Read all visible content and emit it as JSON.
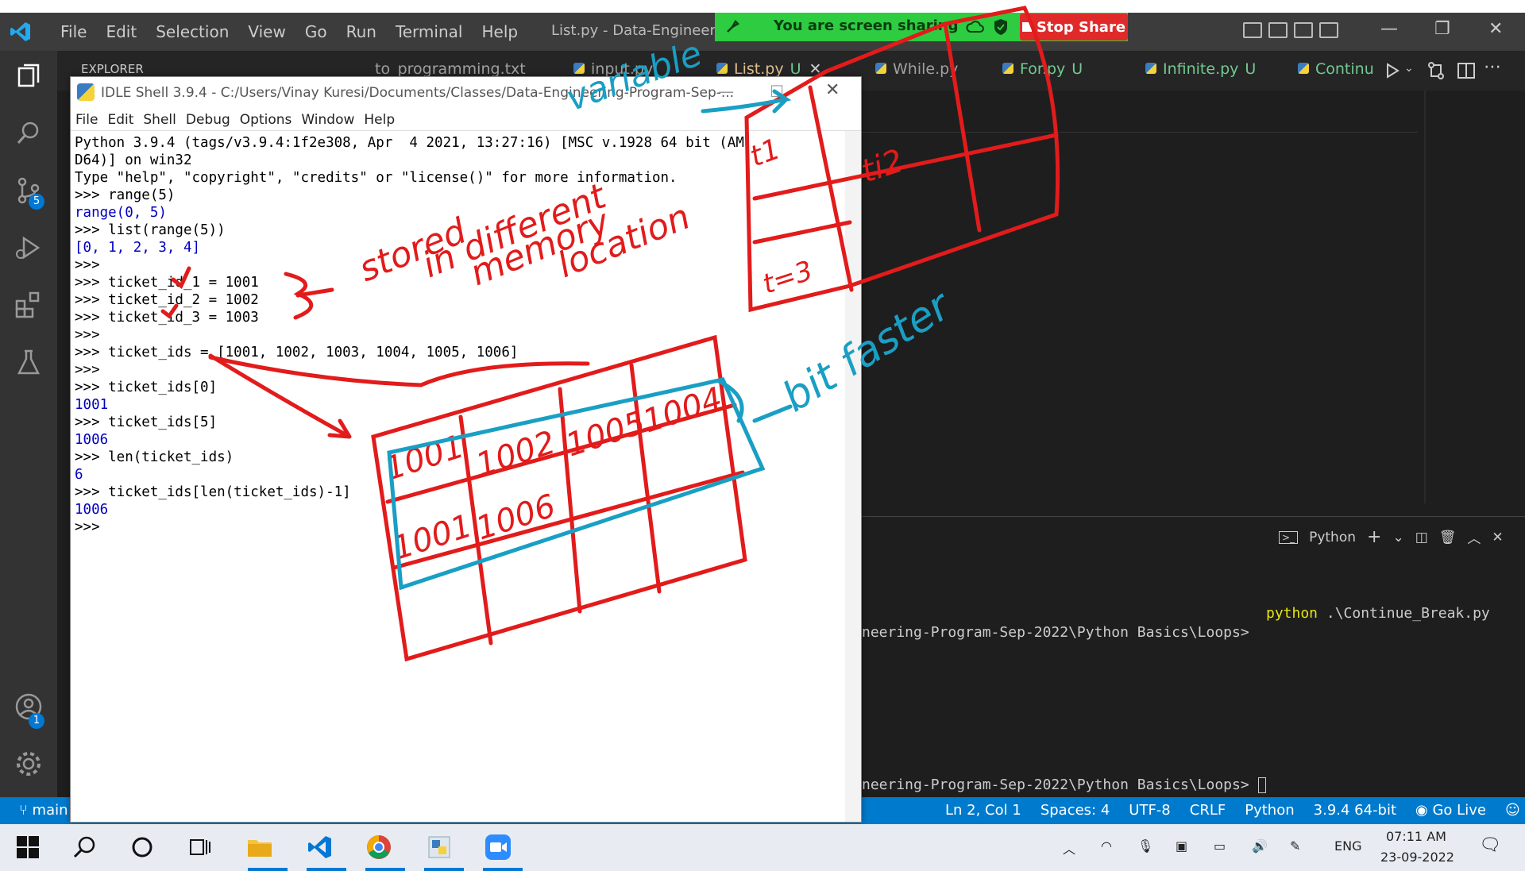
{
  "vscode": {
    "menu": [
      "File",
      "Edit",
      "Selection",
      "View",
      "Go",
      "Run",
      "Terminal",
      "Help"
    ],
    "window_title": "List.py - Data-Engineering",
    "explorer_label": "EXPLORER",
    "tabs": [
      {
        "label": "to_programming.txt",
        "status": ""
      },
      {
        "label": "input.py",
        "status": ""
      },
      {
        "label": "List.py",
        "status": "U"
      },
      {
        "label": "While.py",
        "status": ""
      },
      {
        "label": "For.py",
        "status": "U"
      },
      {
        "label": "Infinite.py",
        "status": "U"
      },
      {
        "label": "Continu",
        "status": ""
      }
    ],
    "source_control_badge": "5",
    "accounts_badge": "1",
    "panel": {
      "terminal_name": "Python",
      "line1_cmd": "python",
      "line1_arg": " .\\Continue_Break.py",
      "line2": "neering-Program-Sep-2022\\Python Basics\\Loops>",
      "line3": "neering-Program-Sep-2022\\Python Basics\\Loops>"
    },
    "status": {
      "branch": "main",
      "position": "Ln 2, Col 1",
      "spaces": "Spaces: 4",
      "encoding": "UTF-8",
      "eol": "CRLF",
      "language": "Python",
      "interpreter": "3.9.4 64-bit",
      "golive": "Go Live"
    }
  },
  "share_banner": {
    "text": "You are screen sharing",
    "stop": "Stop Share"
  },
  "idle": {
    "title": "IDLE Shell 3.9.4 - C:/Users/Vinay Kuresi/Documents/Classes/Data-Engineering-Program-Sep-...",
    "menu": [
      "File",
      "Edit",
      "Shell",
      "Debug",
      "Options",
      "Window",
      "Help"
    ],
    "lines": [
      {
        "t": "Python 3.9.4 (tags/v3.9.4:1f2e308, Apr  4 2021, 13:27:16) [MSC v.1928 64 bit (AM",
        "c": "plain"
      },
      {
        "t": "D64)] on win32",
        "c": "plain"
      },
      {
        "t": "Type \"help\", \"copyright\", \"credits\" or \"license()\" for more information.",
        "c": "plain"
      },
      {
        "t": ">>> range(5)",
        "c": "plain"
      },
      {
        "t": "range(0, 5)",
        "c": "out"
      },
      {
        "t": ">>> list(range(5))",
        "c": "plain"
      },
      {
        "t": "[0, 1, 2, 3, 4]",
        "c": "out"
      },
      {
        "t": ">>>",
        "c": "plain"
      },
      {
        "t": ">>> ticket_id_1 = 1001",
        "c": "plain"
      },
      {
        "t": ">>> ticket_id_2 = 1002",
        "c": "plain"
      },
      {
        "t": ">>> ticket_id_3 = 1003",
        "c": "plain"
      },
      {
        "t": ">>>",
        "c": "plain"
      },
      {
        "t": ">>> ticket_ids = [1001, 1002, 1003, 1004, 1005, 1006]",
        "c": "plain"
      },
      {
        "t": ">>>",
        "c": "plain"
      },
      {
        "t": ">>> ticket_ids[0]",
        "c": "plain"
      },
      {
        "t": "1001",
        "c": "out"
      },
      {
        "t": ">>> ticket_ids[5]",
        "c": "plain"
      },
      {
        "t": "1006",
        "c": "out"
      },
      {
        "t": ">>> len(ticket_ids)",
        "c": "plain"
      },
      {
        "t": "6",
        "c": "out"
      },
      {
        "t": ">>> ticket_ids[len(ticket_ids)-1]",
        "c": "plain"
      },
      {
        "t": "1006",
        "c": "out"
      },
      {
        "t": ">>>",
        "c": "plain"
      }
    ]
  },
  "annotations": {
    "stored": "stored",
    "in_different": "in different",
    "memory": "memory",
    "location": "location",
    "variable": "variable",
    "bit_faster": "bit faster",
    "ti2": "ti2",
    "t1": "t1",
    "t3": "t=3",
    "grid": [
      "1001",
      "1002",
      "1005",
      "1004",
      "1001",
      "1006"
    ]
  },
  "taskbar": {
    "lang": "ENG",
    "time": "07:11 AM",
    "date": "23-09-2022"
  },
  "colors": {
    "accent": "#007acc",
    "share_green": "#2ecc40",
    "stop_red": "#e02a2a",
    "ink_red": "#e21b1b",
    "ink_blue": "#1a9fc4"
  }
}
